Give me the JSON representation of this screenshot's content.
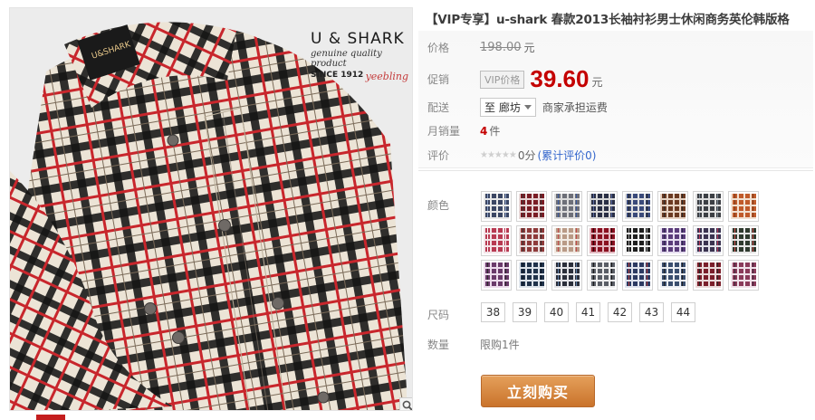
{
  "product": {
    "title": "【VIP专享】u-shark 春款2013长袖衬衫男士休闲商务英伦韩版格",
    "brand": {
      "name": "U & SHARK",
      "tagline": "genuine quality product",
      "since": "SINCE 1912",
      "signature": "yeebling"
    }
  },
  "price": {
    "label": "价格",
    "original": "198.00",
    "unit": "元"
  },
  "promo": {
    "label": "促销",
    "badge": "VIP价格",
    "price": "39.60",
    "unit": "元"
  },
  "shipping": {
    "label": "配送",
    "destination": "至 廊坊",
    "note": "商家承担运费"
  },
  "sales": {
    "label": "月销量",
    "count": "4",
    "unit": "件"
  },
  "rating": {
    "label": "评价",
    "stars": "★★★★★",
    "score": "0分",
    "link": "(累计评价0)"
  },
  "colors": {
    "label": "颜色",
    "swatches": [
      {
        "base": "#3b4663",
        "line": "#e8e8e8",
        "accent": "#8da2c8"
      },
      {
        "base": "#7a1c24",
        "line": "#e6d4d4",
        "accent": "#3a3a3a"
      },
      {
        "base": "#6d6f78",
        "line": "#dcdcdc",
        "accent": "#3d5a9a"
      },
      {
        "base": "#2a2f45",
        "line": "#d8d8d8",
        "accent": "#5a6aa0"
      },
      {
        "base": "#3a4a7a",
        "line": "#e2e2e2",
        "accent": "#222222"
      },
      {
        "base": "#6b3a22",
        "line": "#e6d2c2",
        "accent": "#2b2b2b"
      },
      {
        "base": "#3c3f44",
        "line": "#dedede",
        "accent": "#7c8894"
      },
      {
        "base": "#c05a2a",
        "line": "#f2e0d0",
        "accent": "#7a3a1a"
      },
      {
        "base": "#b83a52",
        "line": "#f3e4e8",
        "accent": "#ffffff"
      },
      {
        "base": "#8e3a3a",
        "line": "#e8dede",
        "accent": "#333333"
      },
      {
        "base": "#b99a86",
        "line": "#f2ebe4",
        "accent": "#c24a4a"
      },
      {
        "base": "#8a1020",
        "line": "#e2b8c0",
        "accent": "#2a0a0a"
      },
      {
        "base": "#1e1e1e",
        "line": "#f2f2f2",
        "accent": "#9a9a9a"
      },
      {
        "base": "#5a3c7a",
        "line": "#e6def0",
        "accent": "#2a2a4a"
      },
      {
        "base": "#3a3350",
        "line": "#e2e2ea",
        "accent": "#b73a5a"
      },
      {
        "base": "#2e3a2e",
        "line": "#e6e6e6",
        "accent": "#c84a4a"
      },
      {
        "base": "#6a3a6a",
        "line": "#ecdcec",
        "accent": "#2a2a2a"
      },
      {
        "base": "#20324a",
        "line": "#dde3ea",
        "accent": "#0a1420"
      },
      {
        "base": "#2a2e3a",
        "line": "#e4e4e8",
        "accent": "#5a7aa2"
      },
      {
        "base": "#5a5e66",
        "line": "#eeeeee",
        "accent": "#1a1a1a"
      },
      {
        "base": "#2c3a62",
        "line": "#e0e4ee",
        "accent": "#b03a3a"
      },
      {
        "base": "#3a4e6e",
        "line": "#eef0f4",
        "accent": "#202020"
      },
      {
        "base": "#7a1e2a",
        "line": "#eadada",
        "accent": "#2a2a2a"
      },
      {
        "base": "#8a3a5a",
        "line": "#f0e2ea",
        "accent": "#3a2a3a"
      }
    ]
  },
  "sizes": {
    "label": "尺码",
    "options": [
      "38",
      "39",
      "40",
      "41",
      "42",
      "43",
      "44"
    ]
  },
  "quantity": {
    "label": "数量",
    "note": "限购1件"
  },
  "actions": {
    "buy_label": "立刻购买"
  },
  "icons": {
    "zoom": "magnifier-icon",
    "dropdown": "caret-down-icon"
  }
}
